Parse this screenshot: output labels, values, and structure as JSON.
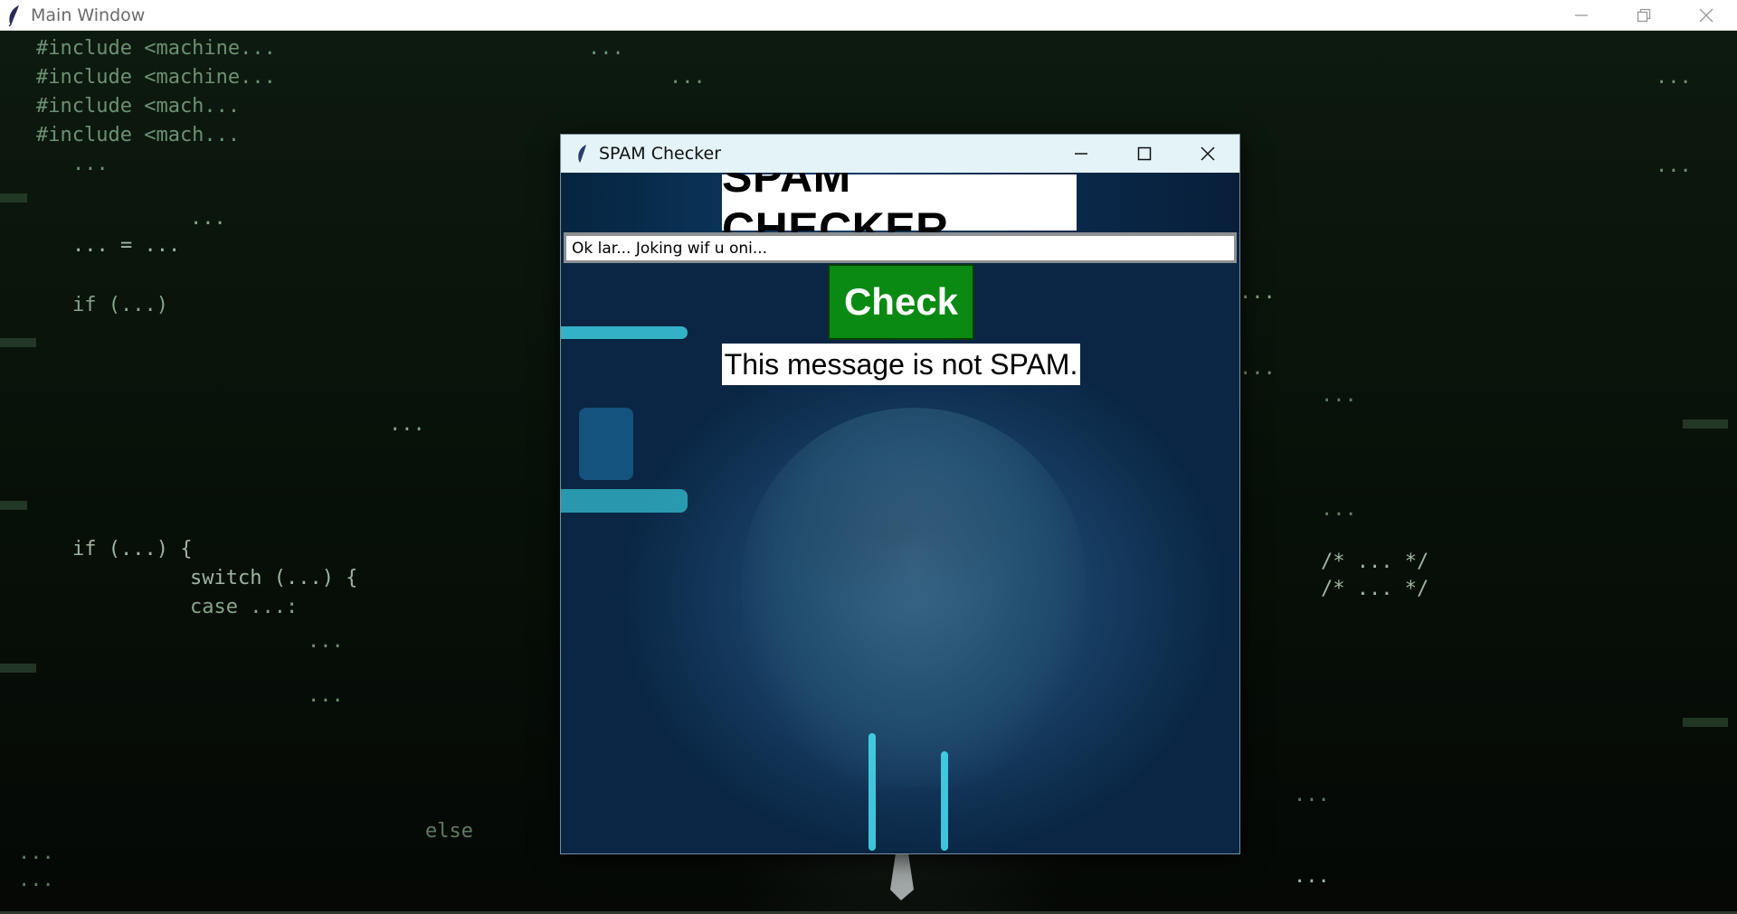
{
  "main_window": {
    "title": "Main Window",
    "icon": "feather-icon",
    "controls": [
      "minimize-icon",
      "restore-icon",
      "close-icon"
    ]
  },
  "dialog": {
    "title": "SPAM Checker",
    "icon": "feather-icon",
    "controls": [
      "minimize-icon",
      "maximize-icon",
      "close-icon"
    ],
    "heading": "SPAM CHECKER",
    "input_value": "Ok lar... Joking wif u oni...",
    "check_button": "Check",
    "result": "This message is not SPAM."
  },
  "colors": {
    "check_button_bg": "#0a8a12",
    "heading_bg": "#ffffff",
    "dialog_titlebar_bg": "#e3f3f7",
    "background_code_text": "#8fb395"
  }
}
